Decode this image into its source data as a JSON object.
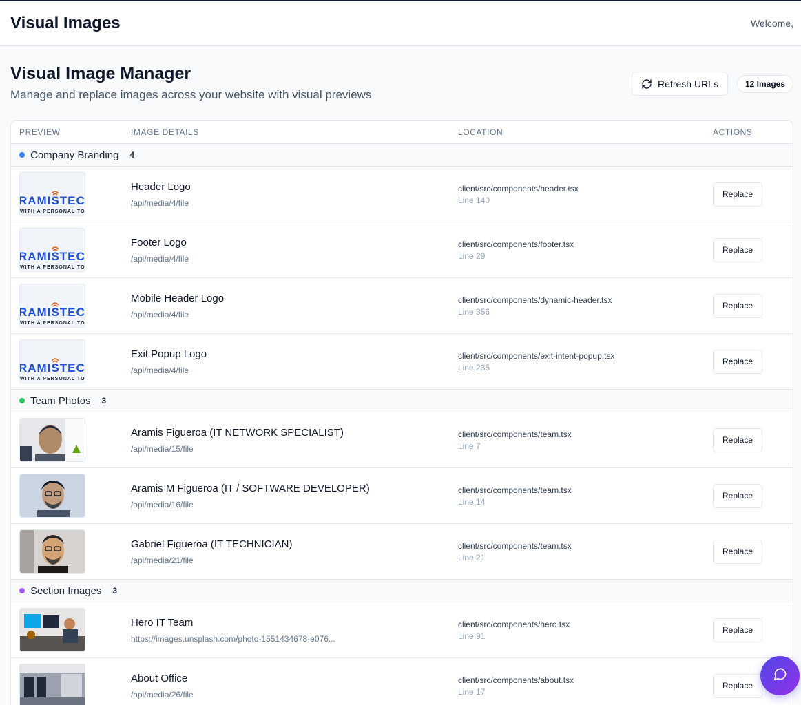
{
  "app": {
    "title": "Visual Images",
    "welcome": "Welcome,"
  },
  "page": {
    "title": "Visual Image Manager",
    "subtitle": "Manage and replace images across your website with visual previews",
    "refresh_label": "Refresh URLs",
    "count_badge": "12 Images"
  },
  "table": {
    "headers": [
      "PREVIEW",
      "IMAGE DETAILS",
      "LOCATION",
      "ACTIONS"
    ],
    "groups": [
      {
        "name": "Company Branding",
        "count": "4",
        "color": "#3b82f6",
        "rows": [
          {
            "name": "Header Logo",
            "path": "/api/media/4/file",
            "file": "client/src/components/header.tsx",
            "line": "Line 140",
            "action": "Replace",
            "thumb": "logo"
          },
          {
            "name": "Footer Logo",
            "path": "/api/media/4/file",
            "file": "client/src/components/footer.tsx",
            "line": "Line 29",
            "action": "Replace",
            "thumb": "logo"
          },
          {
            "name": "Mobile Header Logo",
            "path": "/api/media/4/file",
            "file": "client/src/components/dynamic-header.tsx",
            "line": "Line 356",
            "action": "Replace",
            "thumb": "logo"
          },
          {
            "name": "Exit Popup Logo",
            "path": "/api/media/4/file",
            "file": "client/src/components/exit-intent-popup.tsx",
            "line": "Line 235",
            "action": "Replace",
            "thumb": "logo"
          }
        ]
      },
      {
        "name": "Team Photos",
        "count": "3",
        "color": "#22c55e",
        "rows": [
          {
            "name": "Aramis Figueroa (IT NETWORK SPECIALIST)",
            "path": "/api/media/15/file",
            "file": "client/src/components/team.tsx",
            "line": "Line 7",
            "action": "Replace",
            "thumb": "person-a"
          },
          {
            "name": "Aramis M Figueroa (IT / SOFTWARE DEVELOPER)",
            "path": "/api/media/16/file",
            "file": "client/src/components/team.tsx",
            "line": "Line 14",
            "action": "Replace",
            "thumb": "person-b"
          },
          {
            "name": "Gabriel Figueroa (IT TECHNICIAN)",
            "path": "/api/media/21/file",
            "file": "client/src/components/team.tsx",
            "line": "Line 21",
            "action": "Replace",
            "thumb": "person-c"
          }
        ]
      },
      {
        "name": "Section Images",
        "count": "3",
        "color": "#a855f7",
        "rows": [
          {
            "name": "Hero IT Team",
            "path": "https://images.unsplash.com/photo-1551434678-e076...",
            "file": "client/src/components/hero.tsx",
            "line": "Line 91",
            "action": "Replace",
            "thumb": "office-team"
          },
          {
            "name": "About Office",
            "path": "/api/media/26/file",
            "file": "client/src/components/about.tsx",
            "line": "Line 17",
            "action": "Replace",
            "thumb": "office-room"
          }
        ]
      }
    ]
  },
  "logo_text": {
    "brand": "RAMISTECH",
    "tagline": "WITH A PERSONAL TOUCH"
  }
}
